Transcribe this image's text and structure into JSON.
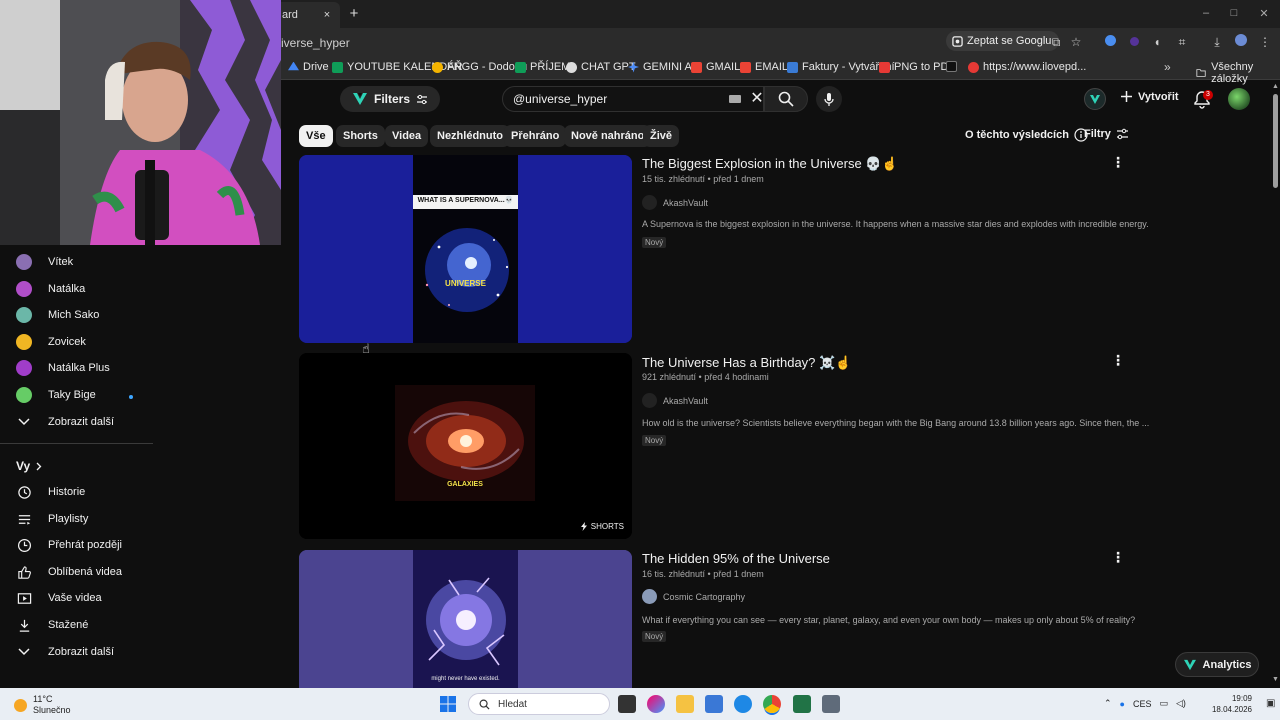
{
  "browser": {
    "tab_title": "ard",
    "tab_close": "×",
    "new_tab": "+",
    "address_text": "iverse_hyper",
    "ask_google": "Zeptat se Googlu",
    "window_controls": [
      "–",
      "□",
      "✕"
    ]
  },
  "bookmarks": {
    "items": [
      {
        "label": "Drive",
        "color": "#4285f4"
      },
      {
        "label": "YOUTUBE KALENDÁŘ",
        "color": "#0f9d58"
      },
      {
        "label": "FNGG - Dodoeu",
        "color": "#f4b400"
      },
      {
        "label": "PŘÍJEM",
        "color": "#0f9d58"
      },
      {
        "label": "CHAT GPT",
        "color": "#dddddd"
      },
      {
        "label": "GEMINI AI",
        "color": "#4c8bf5"
      },
      {
        "label": "GMAIL",
        "color": "#ea4335"
      },
      {
        "label": "EMAIL",
        "color": "#ea4335"
      },
      {
        "label": "Faktury - Vytváření",
        "color": "#3a7bd5"
      },
      {
        "label": "PNG to PDF",
        "color": "#e53935"
      },
      {
        "label": "",
        "color": "#111111"
      },
      {
        "label": "https://www.ilovepd...",
        "color": "#e53935"
      }
    ],
    "more": "»",
    "all_bookmarks": "Všechny záložky"
  },
  "sidebar": {
    "subscriptions": [
      {
        "name": "Vítek",
        "color": "#8a6fb2"
      },
      {
        "name": "Natálka",
        "color": "#b04ec8"
      },
      {
        "name": "Mich Sako",
        "color": "#6bb7a8"
      },
      {
        "name": "Zovicek",
        "color": "#f0b623"
      },
      {
        "name": "Natálka Plus",
        "color": "#a03dc9"
      },
      {
        "name": "Taky Bige",
        "color": "#66cc66"
      }
    ],
    "show_more_subs": "Zobrazit další",
    "you_heading": "Vy",
    "you_items": [
      {
        "label": "Historie",
        "icon": "history-icon"
      },
      {
        "label": "Playlisty",
        "icon": "playlist-icon"
      },
      {
        "label": "Přehrát později",
        "icon": "watch-later-icon"
      },
      {
        "label": "Oblíbená videa",
        "icon": "like-icon"
      },
      {
        "label": "Vaše videa",
        "icon": "your-videos-icon"
      },
      {
        "label": "Stažené",
        "icon": "download-icon"
      }
    ],
    "show_more_you": "Zobrazit další"
  },
  "masthead": {
    "filters_label": "Filters",
    "search_value": "@universe_hyper",
    "create_label": "Vytvořit",
    "notification_count": "3"
  },
  "chips": [
    "Vše",
    "Shorts",
    "Videa",
    "Nezhlédnuto",
    "Přehráno",
    "Nově nahráno",
    "Živě"
  ],
  "about_results": "O těchto výsledcích",
  "filters_link": "Filtry",
  "results": [
    {
      "title": "The Biggest Explosion in the Universe 💀☝️",
      "meta": "15 tis. zhlédnutí • před 1 dnem",
      "channel": "AkashVault",
      "description": "A Supernova is the biggest explosion in the universe. It happens when a massive star dies and explodes with incredible energy.",
      "badge": "Nový",
      "thumb_caption_top": "WHAT IS A SUPERNOVA...💀",
      "thumb_caption": "UNIVERSE"
    },
    {
      "title": "The Universe Has a Birthday? ☠️☝️",
      "meta": "921 zhlédnutí • před 4 hodinami",
      "channel": "AkashVault",
      "description": "How old is the universe? Scientists believe everything began with the Big Bang around 13.8 billion years ago. Since then, the ...",
      "badge": "Nový",
      "thumb_caption": "GALAXIES",
      "shorts_label": "SHORTS"
    },
    {
      "title": "The Hidden 95% of the Universe",
      "meta": "16 tis. zhlédnutí • před 1 dnem",
      "channel": "Cosmic Cartography",
      "description": "What if everything you can see — every star, planet, galaxy, and even your own body — makes up only about 5% of reality?",
      "badge": "Nový",
      "thumb_caption": "might never have existed."
    }
  ],
  "analytics_label": "Analytics",
  "taskbar": {
    "temperature": "11°C",
    "weather": "Slunečno",
    "search_placeholder": "Hledat",
    "language": "CES",
    "time": "19:09",
    "date": "18.04.2026"
  }
}
